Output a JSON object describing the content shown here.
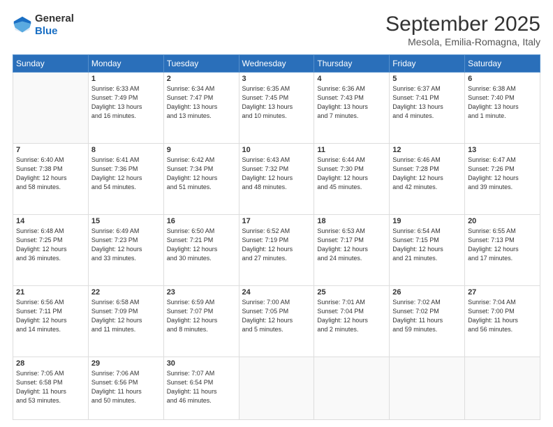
{
  "header": {
    "logo_line1": "General",
    "logo_line2": "Blue",
    "month": "September 2025",
    "location": "Mesola, Emilia-Romagna, Italy"
  },
  "weekdays": [
    "Sunday",
    "Monday",
    "Tuesday",
    "Wednesday",
    "Thursday",
    "Friday",
    "Saturday"
  ],
  "weeks": [
    [
      {
        "day": "",
        "info": ""
      },
      {
        "day": "1",
        "info": "Sunrise: 6:33 AM\nSunset: 7:49 PM\nDaylight: 13 hours\nand 16 minutes."
      },
      {
        "day": "2",
        "info": "Sunrise: 6:34 AM\nSunset: 7:47 PM\nDaylight: 13 hours\nand 13 minutes."
      },
      {
        "day": "3",
        "info": "Sunrise: 6:35 AM\nSunset: 7:45 PM\nDaylight: 13 hours\nand 10 minutes."
      },
      {
        "day": "4",
        "info": "Sunrise: 6:36 AM\nSunset: 7:43 PM\nDaylight: 13 hours\nand 7 minutes."
      },
      {
        "day": "5",
        "info": "Sunrise: 6:37 AM\nSunset: 7:41 PM\nDaylight: 13 hours\nand 4 minutes."
      },
      {
        "day": "6",
        "info": "Sunrise: 6:38 AM\nSunset: 7:40 PM\nDaylight: 13 hours\nand 1 minute."
      }
    ],
    [
      {
        "day": "7",
        "info": "Sunrise: 6:40 AM\nSunset: 7:38 PM\nDaylight: 12 hours\nand 58 minutes."
      },
      {
        "day": "8",
        "info": "Sunrise: 6:41 AM\nSunset: 7:36 PM\nDaylight: 12 hours\nand 54 minutes."
      },
      {
        "day": "9",
        "info": "Sunrise: 6:42 AM\nSunset: 7:34 PM\nDaylight: 12 hours\nand 51 minutes."
      },
      {
        "day": "10",
        "info": "Sunrise: 6:43 AM\nSunset: 7:32 PM\nDaylight: 12 hours\nand 48 minutes."
      },
      {
        "day": "11",
        "info": "Sunrise: 6:44 AM\nSunset: 7:30 PM\nDaylight: 12 hours\nand 45 minutes."
      },
      {
        "day": "12",
        "info": "Sunrise: 6:46 AM\nSunset: 7:28 PM\nDaylight: 12 hours\nand 42 minutes."
      },
      {
        "day": "13",
        "info": "Sunrise: 6:47 AM\nSunset: 7:26 PM\nDaylight: 12 hours\nand 39 minutes."
      }
    ],
    [
      {
        "day": "14",
        "info": "Sunrise: 6:48 AM\nSunset: 7:25 PM\nDaylight: 12 hours\nand 36 minutes."
      },
      {
        "day": "15",
        "info": "Sunrise: 6:49 AM\nSunset: 7:23 PM\nDaylight: 12 hours\nand 33 minutes."
      },
      {
        "day": "16",
        "info": "Sunrise: 6:50 AM\nSunset: 7:21 PM\nDaylight: 12 hours\nand 30 minutes."
      },
      {
        "day": "17",
        "info": "Sunrise: 6:52 AM\nSunset: 7:19 PM\nDaylight: 12 hours\nand 27 minutes."
      },
      {
        "day": "18",
        "info": "Sunrise: 6:53 AM\nSunset: 7:17 PM\nDaylight: 12 hours\nand 24 minutes."
      },
      {
        "day": "19",
        "info": "Sunrise: 6:54 AM\nSunset: 7:15 PM\nDaylight: 12 hours\nand 21 minutes."
      },
      {
        "day": "20",
        "info": "Sunrise: 6:55 AM\nSunset: 7:13 PM\nDaylight: 12 hours\nand 17 minutes."
      }
    ],
    [
      {
        "day": "21",
        "info": "Sunrise: 6:56 AM\nSunset: 7:11 PM\nDaylight: 12 hours\nand 14 minutes."
      },
      {
        "day": "22",
        "info": "Sunrise: 6:58 AM\nSunset: 7:09 PM\nDaylight: 12 hours\nand 11 minutes."
      },
      {
        "day": "23",
        "info": "Sunrise: 6:59 AM\nSunset: 7:07 PM\nDaylight: 12 hours\nand 8 minutes."
      },
      {
        "day": "24",
        "info": "Sunrise: 7:00 AM\nSunset: 7:05 PM\nDaylight: 12 hours\nand 5 minutes."
      },
      {
        "day": "25",
        "info": "Sunrise: 7:01 AM\nSunset: 7:04 PM\nDaylight: 12 hours\nand 2 minutes."
      },
      {
        "day": "26",
        "info": "Sunrise: 7:02 AM\nSunset: 7:02 PM\nDaylight: 11 hours\nand 59 minutes."
      },
      {
        "day": "27",
        "info": "Sunrise: 7:04 AM\nSunset: 7:00 PM\nDaylight: 11 hours\nand 56 minutes."
      }
    ],
    [
      {
        "day": "28",
        "info": "Sunrise: 7:05 AM\nSunset: 6:58 PM\nDaylight: 11 hours\nand 53 minutes."
      },
      {
        "day": "29",
        "info": "Sunrise: 7:06 AM\nSunset: 6:56 PM\nDaylight: 11 hours\nand 50 minutes."
      },
      {
        "day": "30",
        "info": "Sunrise: 7:07 AM\nSunset: 6:54 PM\nDaylight: 11 hours\nand 46 minutes."
      },
      {
        "day": "",
        "info": ""
      },
      {
        "day": "",
        "info": ""
      },
      {
        "day": "",
        "info": ""
      },
      {
        "day": "",
        "info": ""
      }
    ]
  ]
}
